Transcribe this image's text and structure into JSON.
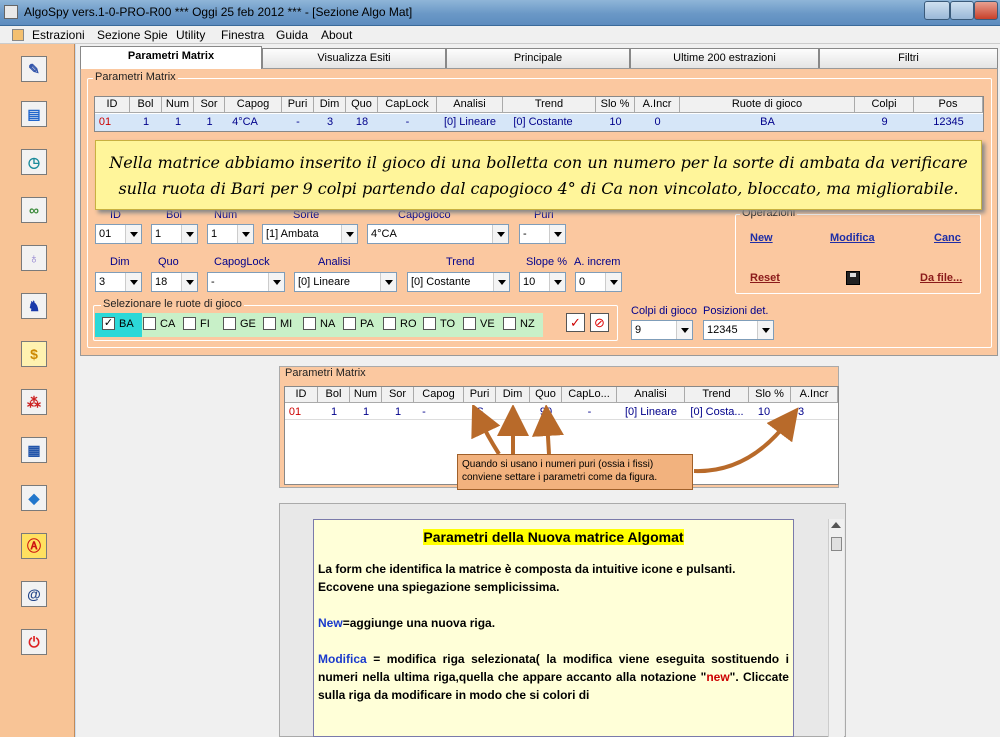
{
  "window": {
    "title": "AlgoSpy vers.1-0-PRO-R00  ***  Oggi 25 feb 2012  ***  - [Sezione Algo Mat]"
  },
  "menu": [
    "Estrazioni",
    "Sezione Spie",
    "Utility",
    "Finestra",
    "Guida",
    "About"
  ],
  "tabs": [
    "Parametri Matrix",
    "Visualizza Esiti",
    "Principale",
    "Ultime 200 estrazioni",
    "Filtri"
  ],
  "sidebar_icons": [
    "pencil-icon",
    "book-icon",
    "clock-icon",
    "binoculars-icon",
    "lightbulb-icon",
    "horse-icon",
    "dollar-icon",
    "balls-icon",
    "calendar-icon",
    "diamond-icon",
    "letter-a-icon",
    "at-icon",
    "power-icon"
  ],
  "params": {
    "group_label": "Parametri Matrix",
    "headers": [
      "ID",
      "Bol",
      "Num",
      "Sor",
      "Capog",
      "Puri",
      "Dim",
      "Quo",
      "CapLock",
      "Analisi",
      "Trend",
      "Slo %",
      "A.Incr",
      "Ruote di gioco",
      "Colpi",
      "Pos"
    ],
    "row": [
      "01",
      "1",
      "1",
      "1",
      "4°CA",
      "-",
      "3",
      "18",
      "-",
      "[0] Lineare",
      "[0] Costante",
      "10",
      "0",
      "BA",
      "9",
      "12345"
    ]
  },
  "callout": "Nella matrice abbiamo inserito il gioco di una bolletta con un numero per la sorte di ambata da verificare sulla ruota di Bari per 9 colpi partendo dal capogioco 4° di Ca non vincolato, bloccato, ma migliorabile.",
  "form": {
    "labels": {
      "id": "ID",
      "bol": "Bol",
      "num": "Num",
      "sorte": "Sorte",
      "capogioco": "Capogioco",
      "puri": "Puri",
      "dim": "Dim",
      "quo": "Quo",
      "capoglock": "CapogLock",
      "analisi": "Analisi",
      "trend": "Trend",
      "slope": "Slope %",
      "aincrem": "A. increm",
      "colpi": "Colpi di gioco",
      "posizioni": "Posizioni det."
    },
    "values": {
      "id": "01",
      "bol": "1",
      "num": "1",
      "sorte": "[1] Ambata",
      "capogioco": "4°CA",
      "puri": "-",
      "dim": "3",
      "quo": "18",
      "capoglock": "-",
      "analisi": "[0] Lineare",
      "trend": "[0] Costante",
      "slope": "10",
      "aincrem": "0",
      "colpi": "9",
      "posizioni": "12345"
    }
  },
  "operazioni": {
    "label": "Operazioni",
    "new": "New",
    "modifica": "Modifica",
    "canc": "Canc",
    "reset": "Reset",
    "dafile": "Da file..."
  },
  "ruote": {
    "label": "Selezionare le ruote di gioco",
    "items": [
      "BA",
      "CA",
      "FI",
      "GE",
      "MI",
      "NA",
      "PA",
      "RO",
      "TO",
      "VE",
      "NZ"
    ],
    "checked": "BA"
  },
  "matrix2": {
    "label": "Parametri Matrix",
    "headers": [
      "ID",
      "Bol",
      "Num",
      "Sor",
      "Capog",
      "Puri",
      "Dim",
      "Quo",
      "CapLo...",
      "Analisi",
      "Trend",
      "Slo %",
      "A.Incr"
    ],
    "row": [
      "01",
      "1",
      "1",
      "1",
      "-",
      "S",
      "2",
      "90",
      "-",
      "[0] Lineare",
      "[0] Costa...",
      "10",
      "3"
    ]
  },
  "tip": "Quando si usano i numeri puri (ossia i fissi) conviene settare i parametri come da figura.",
  "doc": {
    "title": "Parametri della Nuova matrice Algomat",
    "p1": "La form che identifica la matrice è composta da intuitive icone e pulsanti. Eccovene una spiegazione semplicissima.",
    "new_kw": "New",
    "new_txt": "=aggiunge una nuova riga.",
    "mod_kw": "Modifica",
    "mod_txt": " = modifica riga selezionata( la modifica viene eseguita sostituendo i numeri nella ultima riga,quella che appare accanto alla notazione \"",
    "mod_new": "new",
    "mod_end": "\". Cliccate sulla riga da modificare in modo che si colori di"
  },
  "colors": {
    "accent": "#fbc8a0",
    "link": "#1f2ea6",
    "selected_row": "#d6e6f8"
  }
}
